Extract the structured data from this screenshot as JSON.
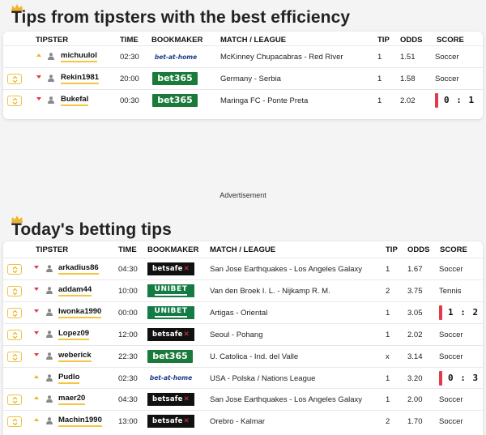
{
  "colors": {
    "accent": "#f5c542",
    "down": "#e23a4a",
    "up": "#f0b429",
    "bet365_green": "#1a7a3a",
    "unibet_green": "#147b45"
  },
  "section1": {
    "title": "Tips from tipsters with the best efficiency",
    "headers": {
      "tipster": "TIPSTER",
      "time": "TIME",
      "bookmaker": "BOOKMAKER",
      "match": "MATCH / LEAGUE",
      "tip": "TIP",
      "odds": "ODDS",
      "score": "SCORE"
    },
    "rows": [
      {
        "expand": false,
        "trend": "up",
        "tipster": "michuulol",
        "time": "02:30",
        "bookmaker": "bet-at-home",
        "match": "McKinney Chupacabras - Red River",
        "tip": "1",
        "odds": "1.51",
        "score": "Soccer",
        "is_score": false
      },
      {
        "expand": true,
        "trend": "down",
        "tipster": "Rekin1981",
        "time": "20:00",
        "bookmaker": "bet365",
        "match": "Germany - Serbia",
        "tip": "1",
        "odds": "1.58",
        "score": "Soccer",
        "is_score": false
      },
      {
        "expand": true,
        "trend": "down",
        "tipster": "Bukefal",
        "time": "00:30",
        "bookmaker": "bet365",
        "match": "Maringa FC - Ponte Preta",
        "tip": "1",
        "odds": "2.02",
        "score": "0 : 1",
        "is_score": true
      }
    ]
  },
  "advertisement": "Advertisement",
  "section2": {
    "title": "Today's betting tips",
    "headers": {
      "tipster": "TIPSTER",
      "time": "TIME",
      "bookmaker": "BOOKMAKER",
      "match": "MATCH / LEAGUE",
      "tip": "TIP",
      "odds": "ODDS",
      "score": "SCORE"
    },
    "rows": [
      {
        "expand": true,
        "trend": "down",
        "tipster": "arkadius86",
        "time": "04:30",
        "bookmaker": "betsafe",
        "match": "San Jose Earthquakes - Los Angeles Galaxy",
        "tip": "1",
        "odds": "1.67",
        "score": "Soccer",
        "is_score": false
      },
      {
        "expand": true,
        "trend": "down",
        "tipster": "addam44",
        "time": "10:00",
        "bookmaker": "UNIBET",
        "match": "Van den Broek I. L. - Nijkamp R. M.",
        "tip": "2",
        "odds": "3.75",
        "score": "Tennis",
        "is_score": false
      },
      {
        "expand": true,
        "trend": "down",
        "tipster": "Iwonka1990",
        "time": "00:00",
        "bookmaker": "UNIBET",
        "match": "Artigas - Oriental",
        "tip": "1",
        "odds": "3.05",
        "score": "1 : 2",
        "is_score": true
      },
      {
        "expand": true,
        "trend": "down",
        "tipster": "Lopez09",
        "time": "12:00",
        "bookmaker": "betsafe",
        "match": "Seoul - Pohang",
        "tip": "1",
        "odds": "2.02",
        "score": "Soccer",
        "is_score": false
      },
      {
        "expand": true,
        "trend": "down",
        "tipster": "weberick",
        "time": "22:30",
        "bookmaker": "bet365",
        "match": "U. Catolica - Ind. del Valle",
        "tip": "x",
        "odds": "3.14",
        "score": "Soccer",
        "is_score": false
      },
      {
        "expand": false,
        "trend": "up",
        "tipster": "Pudlo",
        "time": "02:30",
        "bookmaker": "bet-at-home",
        "match": "USA - Polska / Nations League",
        "tip": "1",
        "odds": "3.20",
        "score": "0 : 3",
        "is_score": true
      },
      {
        "expand": true,
        "trend": "up",
        "tipster": "maer20",
        "time": "04:30",
        "bookmaker": "betsafe",
        "match": "San Jose Earthquakes - Los Angeles Galaxy",
        "tip": "1",
        "odds": "2.00",
        "score": "Soccer",
        "is_score": false
      },
      {
        "expand": true,
        "trend": "up",
        "tipster": "Machin1990",
        "time": "13:00",
        "bookmaker": "betsafe",
        "match": "Orebro - Kalmar",
        "tip": "2",
        "odds": "1.70",
        "score": "Soccer",
        "is_score": false
      }
    ]
  }
}
